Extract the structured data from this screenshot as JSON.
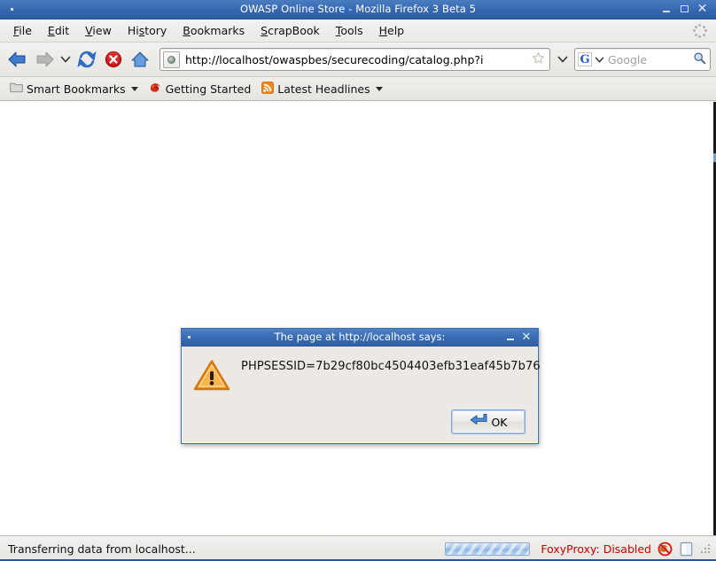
{
  "window": {
    "title": "OWASP Online Store - Mozilla Firefox 3 Beta 5",
    "minimize_label": "Minimize",
    "maximize_label": "Maximize",
    "close_label": "Close"
  },
  "menubar": {
    "items": [
      {
        "label": "File",
        "accesskey_index": 0
      },
      {
        "label": "Edit",
        "accesskey_index": 0
      },
      {
        "label": "View",
        "accesskey_index": 0
      },
      {
        "label": "History",
        "accesskey_index": 2
      },
      {
        "label": "Bookmarks",
        "accesskey_index": 0
      },
      {
        "label": "ScrapBook",
        "accesskey_index": 0
      },
      {
        "label": "Tools",
        "accesskey_index": 0
      },
      {
        "label": "Help",
        "accesskey_index": 0
      }
    ],
    "throbber_name": "throbber-icon"
  },
  "navbar": {
    "back_label": "Back",
    "forward_label": "Forward",
    "history_dropdown_label": "Recent pages",
    "reload_label": "Reload",
    "stop_label": "Stop",
    "home_label": "Home",
    "url": {
      "value": "http://localhost/owaspbes/securecoding/catalog.php?i",
      "favicon_name": "site-favicon",
      "star_label": "Bookmark this page",
      "dropdown_label": "Show history"
    },
    "search": {
      "engine": "G",
      "placeholder": "Google",
      "go_label": "Search"
    }
  },
  "bookmarks_bar": {
    "items": [
      {
        "label": "Smart Bookmarks",
        "icon": "folder-icon",
        "has_chevron": true
      },
      {
        "label": "Getting Started",
        "icon": "firefox-icon",
        "has_chevron": false
      },
      {
        "label": "Latest Headlines",
        "icon": "rss-icon",
        "has_chevron": true
      }
    ]
  },
  "dialog": {
    "title": "The page at http://localhost says:",
    "message": "PHPSESSID=7b29cf80bc4504403efb31eaf45b7b76",
    "icon": "warning-triangle-icon",
    "ok_label": "OK",
    "minimize_label": "Minimize",
    "close_label": "Close"
  },
  "statusbar": {
    "status_text": "Transferring data from localhost...",
    "progress_percent": 100,
    "foxyproxy_text": "FoxyProxy: Disabled",
    "foxyproxy_color": "#cc0000",
    "icons": [
      "foxyproxy-disabled-icon",
      "page-info-icon"
    ],
    "grip_name": "resize-grip"
  },
  "colors": {
    "titlebar_blue": "#3a6cb4",
    "dialog_border": "#3a6cb4",
    "warning_orange": "#f29222",
    "status_red": "#cc0000"
  }
}
